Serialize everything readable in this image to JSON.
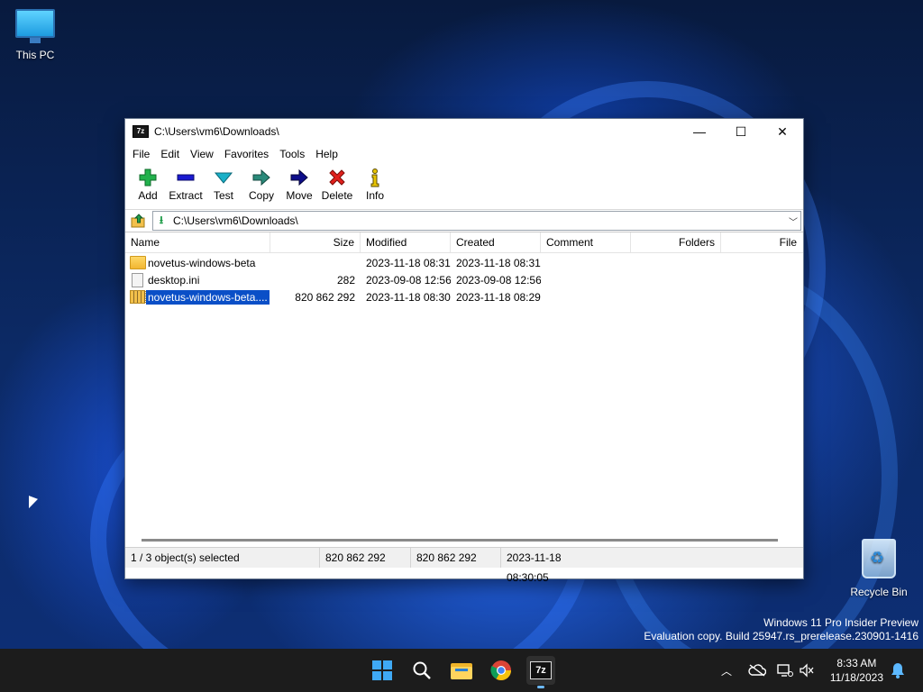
{
  "desktop": {
    "icons": [
      {
        "label": "This PC",
        "icon": "this-pc-icon"
      },
      {
        "label": "Recycle Bin",
        "icon": "recycle-bin-icon"
      }
    ],
    "watermark_line1": "Windows 11 Pro Insider Preview",
    "watermark_line2": "Evaluation copy. Build 25947.rs_prerelease.230901-1416"
  },
  "window": {
    "app_icon_text": "7z",
    "title": "C:\\Users\\vm6\\Downloads\\",
    "minimize": "—",
    "maximize": "☐",
    "close": "✕"
  },
  "menu": [
    "File",
    "Edit",
    "View",
    "Favorites",
    "Tools",
    "Help"
  ],
  "toolbar": [
    {
      "label": "Add",
      "icon": "add-plus-icon",
      "color": "#22b14c"
    },
    {
      "label": "Extract",
      "icon": "extract-minus-icon",
      "color": "#1a1ad1"
    },
    {
      "label": "Test",
      "icon": "test-check-icon",
      "color": "#1ab0c8"
    },
    {
      "label": "Copy",
      "icon": "copy-arrow-icon",
      "color": "#2a8a7a"
    },
    {
      "label": "Move",
      "icon": "move-arrow-icon",
      "color": "#0d0d8a"
    },
    {
      "label": "Delete",
      "icon": "delete-x-icon",
      "color": "#e0201c"
    },
    {
      "label": "Info",
      "icon": "info-icon",
      "color": "#c8a800"
    }
  ],
  "address": {
    "path": "C:\\Users\\vm6\\Downloads\\"
  },
  "columns": [
    "Name",
    "Size",
    "Modified",
    "Created",
    "Comment",
    "Folders",
    "File"
  ],
  "files": [
    {
      "type": "folder",
      "name": "novetus-windows-beta",
      "size": "",
      "modified": "2023-11-18 08:31",
      "created": "2023-11-18 08:31",
      "selected": false
    },
    {
      "type": "ini",
      "name": "desktop.ini",
      "size": "282",
      "modified": "2023-09-08 12:56",
      "created": "2023-09-08 12:56",
      "selected": false
    },
    {
      "type": "zip",
      "name": "novetus-windows-beta....",
      "size": "820 862 292",
      "modified": "2023-11-18 08:30",
      "created": "2023-11-18 08:29",
      "selected": true
    }
  ],
  "status": {
    "selected": "1 / 3 object(s) selected",
    "size1": "820 862 292",
    "size2": "820 862 292",
    "date": "2023-11-18 08:30:05"
  },
  "taskbar": {
    "apps": [
      "start-icon",
      "search-icon",
      "file-explorer-icon",
      "chrome-icon",
      "7zip-icon"
    ],
    "time": "8:33 AM",
    "date": "11/18/2023"
  },
  "colors": {
    "selection": "#0a4fc7",
    "taskbar": "#1c1c1c",
    "accent": "#3fa9f5"
  }
}
